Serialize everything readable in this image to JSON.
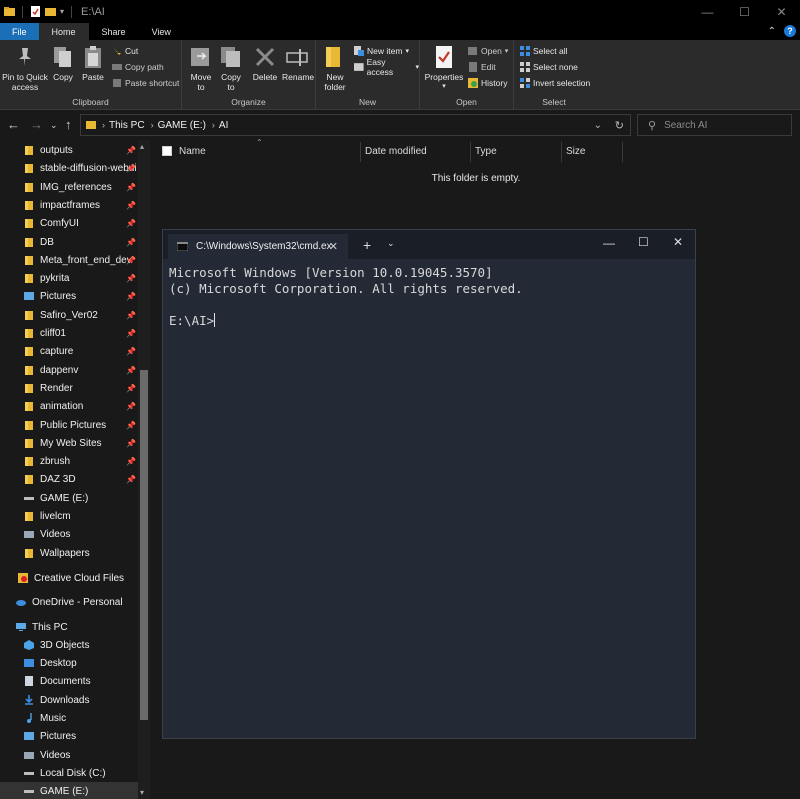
{
  "window": {
    "title": "E:\\AI",
    "controls": [
      "—",
      "☐",
      "✕"
    ]
  },
  "ribbon_tabs": [
    "File",
    "Home",
    "Share",
    "View"
  ],
  "ribbon": {
    "clipboard": {
      "pin_label_1": "Pin to Quick",
      "pin_label_2": "access",
      "copy": "Copy",
      "paste": "Paste",
      "cut": "Cut",
      "copy_path": "Copy path",
      "paste_shortcut": "Paste shortcut",
      "group": "Clipboard"
    },
    "organize": {
      "move_1": "Move",
      "move_2": "to",
      "copy_1": "Copy",
      "copy_2": "to",
      "delete": "Delete",
      "rename": "Rename",
      "group": "Organize"
    },
    "new": {
      "new_folder_1": "New",
      "new_folder_2": "folder",
      "new_item": "New item",
      "easy_access": "Easy access",
      "group": "New"
    },
    "open": {
      "properties": "Properties",
      "open": "Open",
      "edit": "Edit",
      "history": "History",
      "group": "Open"
    },
    "select": {
      "select_all": "Select all",
      "select_none": "Select none",
      "invert": "Invert selection",
      "group": "Select"
    }
  },
  "address": {
    "crumbs": [
      "This PC",
      "GAME (E:)",
      "AI"
    ],
    "search_placeholder": "Search AI"
  },
  "sidebar": {
    "quick_access": [
      {
        "label": "outputs",
        "pinned": true
      },
      {
        "label": "stable-diffusion-webui",
        "pinned": true
      },
      {
        "label": "IMG_references",
        "pinned": true
      },
      {
        "label": "impactframes",
        "pinned": true
      },
      {
        "label": "ComfyUI",
        "pinned": true
      },
      {
        "label": "DB",
        "pinned": true
      },
      {
        "label": "Meta_front_end_dev",
        "pinned": true
      },
      {
        "label": "pykrita",
        "pinned": true
      },
      {
        "label": "Pictures",
        "pinned": true
      },
      {
        "label": "Safiro_Ver02",
        "pinned": true
      },
      {
        "label": "cliff01",
        "pinned": true
      },
      {
        "label": "capture",
        "pinned": true
      },
      {
        "label": "dappenv",
        "pinned": true
      },
      {
        "label": "Render",
        "pinned": true
      },
      {
        "label": "animation",
        "pinned": true
      },
      {
        "label": "Public Pictures",
        "pinned": true
      },
      {
        "label": "My Web Sites",
        "pinned": true
      },
      {
        "label": "zbrush",
        "pinned": true
      },
      {
        "label": "DAZ 3D",
        "pinned": true
      },
      {
        "label": "GAME (E:)",
        "pinned": false
      },
      {
        "label": "livelcm",
        "pinned": false
      },
      {
        "label": "Videos",
        "pinned": false
      },
      {
        "label": "Wallpapers",
        "pinned": false
      }
    ],
    "creative_cloud": "Creative Cloud Files",
    "onedrive": "OneDrive - Personal",
    "this_pc": "This PC",
    "this_pc_items": [
      "3D Objects",
      "Desktop",
      "Documents",
      "Downloads",
      "Music",
      "Pictures",
      "Videos",
      "Local Disk (C:)",
      "GAME (E:)"
    ]
  },
  "content": {
    "columns": [
      "Name",
      "Date modified",
      "Type",
      "Size"
    ],
    "empty_message": "This folder is empty."
  },
  "terminal": {
    "tab_title": "C:\\Windows\\System32\\cmd.ex",
    "line1": "Microsoft Windows [Version 10.0.19045.3570]",
    "line2": "(c) Microsoft Corporation. All rights reserved.",
    "prompt": "E:\\AI>"
  },
  "colors": {
    "accent": "#1a6fb7",
    "folder": "#e8b733",
    "terminal_bg": "#232935"
  }
}
